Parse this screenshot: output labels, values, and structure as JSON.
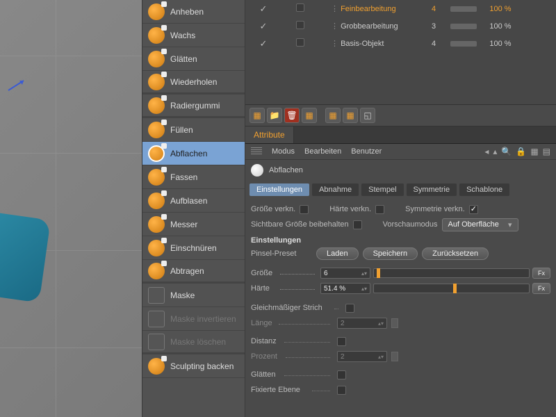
{
  "tools": [
    {
      "label": "Anheben",
      "sep": false
    },
    {
      "label": "Wachs",
      "sep": false
    },
    {
      "label": "Glätten",
      "sep": false
    },
    {
      "label": "Wiederholen",
      "sep": true
    },
    {
      "label": "Radiergummi",
      "sep": true
    },
    {
      "label": "Füllen",
      "sep": false
    },
    {
      "label": "Abflachen",
      "sep": false,
      "selected": true
    },
    {
      "label": "Fassen",
      "sep": false
    },
    {
      "label": "Aufblasen",
      "sep": false
    },
    {
      "label": "Messer",
      "sep": false
    },
    {
      "label": "Einschnüren",
      "sep": false
    },
    {
      "label": "Abtragen",
      "sep": true
    },
    {
      "label": "Maske",
      "sep": false,
      "iconSq": true
    },
    {
      "label": "Maske invertieren",
      "sep": false,
      "iconSq": true,
      "disabled": true
    },
    {
      "label": "Maske löschen",
      "sep": true,
      "iconSq": true,
      "disabled": true
    },
    {
      "label": "Sculpting backen",
      "sep": false
    }
  ],
  "layers": [
    {
      "name": "Feinbearbeitung",
      "num": "4",
      "pct": "100 %",
      "hl": true
    },
    {
      "name": "Grobbearbeitung",
      "num": "3",
      "pct": "100 %"
    },
    {
      "name": "Basis-Objekt",
      "num": "4",
      "pct": "100 %"
    }
  ],
  "attributeTab": "Attribute",
  "menu": {
    "modus": "Modus",
    "bearbeiten": "Bearbeiten",
    "benutzer": "Benutzer"
  },
  "title": "Abflachen",
  "propTabs": [
    "Einstellungen",
    "Abnahme",
    "Stempel",
    "Symmetrie",
    "Schablone"
  ],
  "checks": {
    "groesse_verkn": "Größe verkn.",
    "haerte_verkn": "Härte verkn.",
    "symmetrie_verkn": "Symmetrie verkn.",
    "sichtbare": "Sichtbare Größe beibehalten",
    "vorschau": "Vorschaumodus",
    "vorschau_val": "Auf Oberfläche"
  },
  "sectionHeader": "Einstellungen",
  "preset": {
    "label": "Pinsel-Preset",
    "laden": "Laden",
    "speichern": "Speichern",
    "zurueck": "Zurücksetzen"
  },
  "sliders": {
    "groesse": {
      "label": "Größe",
      "val": "6",
      "pos": 2,
      "fx": "Fx"
    },
    "haerte": {
      "label": "Härte",
      "val": "51.4 %",
      "pos": 51,
      "fx": "Fx"
    }
  },
  "params": {
    "gleich": "Gleichmäßiger Strich",
    "laenge": {
      "label": "Länge",
      "val": "2"
    },
    "distanz": "Distanz",
    "prozent": {
      "label": "Prozent",
      "val": "2"
    },
    "glaetten": "Glätten",
    "fixebene": "Fixierte Ebene"
  }
}
